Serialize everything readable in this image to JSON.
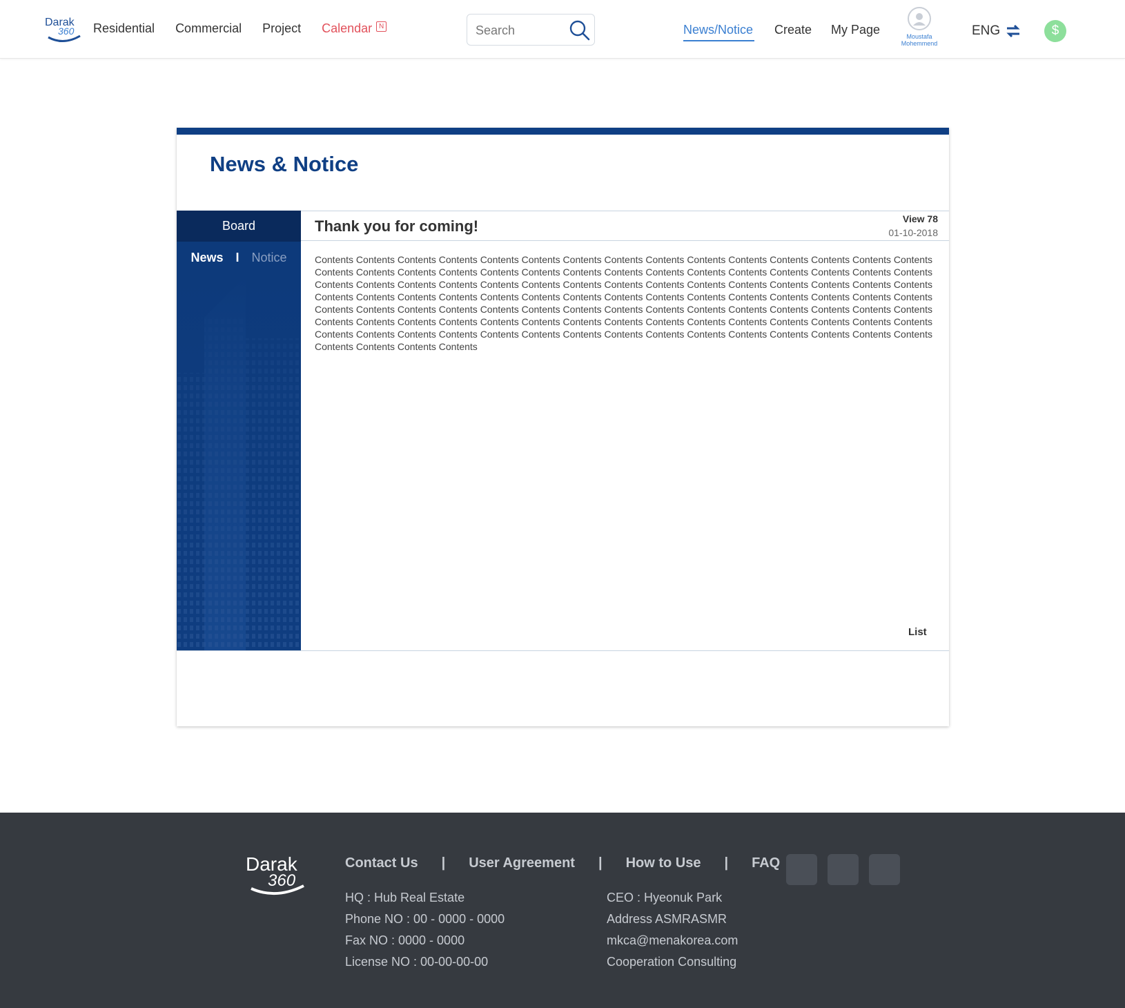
{
  "header": {
    "logo_text": "Darak 360",
    "nav_left": [
      {
        "label": "Residential"
      },
      {
        "label": "Commercial"
      },
      {
        "label": "Project"
      },
      {
        "label": "Calendar",
        "badge": "N"
      }
    ],
    "search": {
      "placeholder": "Search"
    },
    "nav_right": [
      {
        "label": "News/Notice",
        "active": true
      },
      {
        "label": "Create"
      },
      {
        "label": "My Page"
      }
    ],
    "user": {
      "name_line1": "Moustafa",
      "name_line2": "Mohemmend"
    },
    "language": "ENG",
    "currency_symbol": "$",
    "colors": {
      "accent": "#3a7fd1",
      "calendar": "#e2515b",
      "currency": "#8ddf9b"
    }
  },
  "page": {
    "title": "News & Notice",
    "sidebar": {
      "board_label": "Board",
      "tab_news": "News",
      "tab_separator": "I",
      "tab_notice": "Notice"
    },
    "post": {
      "title": "Thank you for coming!",
      "views": "View 78",
      "date": "01-10-2018",
      "body": "Contents Contents Contents Contents Contents Contents Contents Contents Contents Contents Contents Contents Contents Contents Contents Contents Contents Contents Contents Contents Contents Contents Contents Contents Contents Contents Contents Contents Contents Contents Contents Contents Contents Contents Contents Contents Contents Contents Contents Contents Contents Contents Contents Contents Contents Contents Contents Contents Contents Contents Contents Contents Contents Contents Contents Contents Contents Contents Contents Contents Contents Contents Contents Contents Contents Contents Contents Contents Contents Contents Contents Contents Contents Contents Contents Contents Contents Contents Contents Contents Contents Contents Contents Contents Contents Contents Contents Contents Contents Contents Contents Contents Contents Contents Contents Contents Contents Contents Contents Contents Contents Contents Contents Contents Contents Contents Contents Contents Contents"
    },
    "list_label": "List",
    "colors": {
      "brand": "#0f3f84",
      "sidebar": "#0d3a7b"
    }
  },
  "footer": {
    "logo_text": "Darak 360",
    "links": [
      "Contact Us",
      "User Agreement",
      "How to Use",
      "FAQ"
    ],
    "separator": "|",
    "info_left": [
      "HQ : Hub Real Estate",
      "Phone NO : 00 - 0000 - 0000",
      "Fax NO : 0000 - 0000",
      "License NO : 00-00-00-00"
    ],
    "info_right": [
      "CEO : Hyeonuk Park",
      "Address ASMRASMR",
      "mkca@menakorea.com",
      "Cooperation Consulting"
    ]
  }
}
